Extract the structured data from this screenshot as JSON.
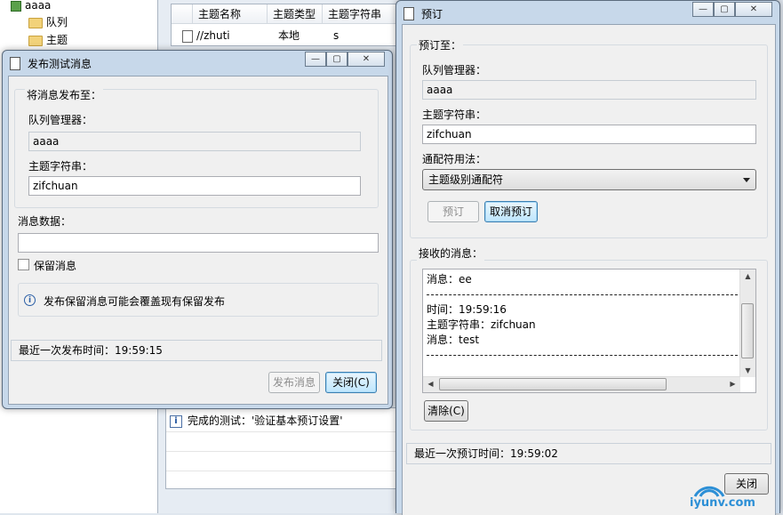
{
  "background": {
    "tree": [
      {
        "label": "aaaa",
        "icon": "queue-manager-icon"
      },
      {
        "label": "队列",
        "icon": "folder-icon"
      },
      {
        "label": "主题",
        "icon": "folder-icon"
      }
    ],
    "topic_table": {
      "columns": [
        "主题名称",
        "主题类型",
        "主题字符串"
      ],
      "rows": [
        {
          "name": "//zhuti",
          "type": "本地",
          "string": "s"
        }
      ]
    },
    "log": {
      "message": "完成的测试：'验证基本预订设置'"
    }
  },
  "publish_dialog": {
    "title": "发布测试消息",
    "group_label": "将消息发布至：",
    "qmgr_label": "队列管理器：",
    "qmgr_value": "aaaa",
    "topic_label": "主题字符串：",
    "topic_value": "zifchuan",
    "data_label": "消息数据：",
    "data_value": "",
    "retain_label": "保留消息",
    "retain_checked": false,
    "info_text": "发布保留消息可能会覆盖现有保留发布",
    "status": "最近一次发布时间：19:59:15",
    "publish_button": "发布消息",
    "close_button": "关闭(C)"
  },
  "subscribe_dialog": {
    "title": "预订",
    "group_label": "预订至：",
    "qmgr_label": "队列管理器：",
    "qmgr_value": "aaaa",
    "topic_label": "主题字符串：",
    "topic_value": "zifchuan",
    "wildcard_label": "通配符用法：",
    "wildcard_value": "主题级别通配符",
    "subscribe_button": "预订",
    "unsubscribe_button": "取消预订",
    "received_label": "接收的消息：",
    "received_lines": [
      "消息：ee",
      "时间：19:59:16",
      "主题字符串：zifchuan",
      "消息：test"
    ],
    "clear_button": "清除(C)",
    "status": "最近一次预订时间：19:59:02",
    "close_button": "关闭"
  },
  "watermark": "iyunv.com"
}
